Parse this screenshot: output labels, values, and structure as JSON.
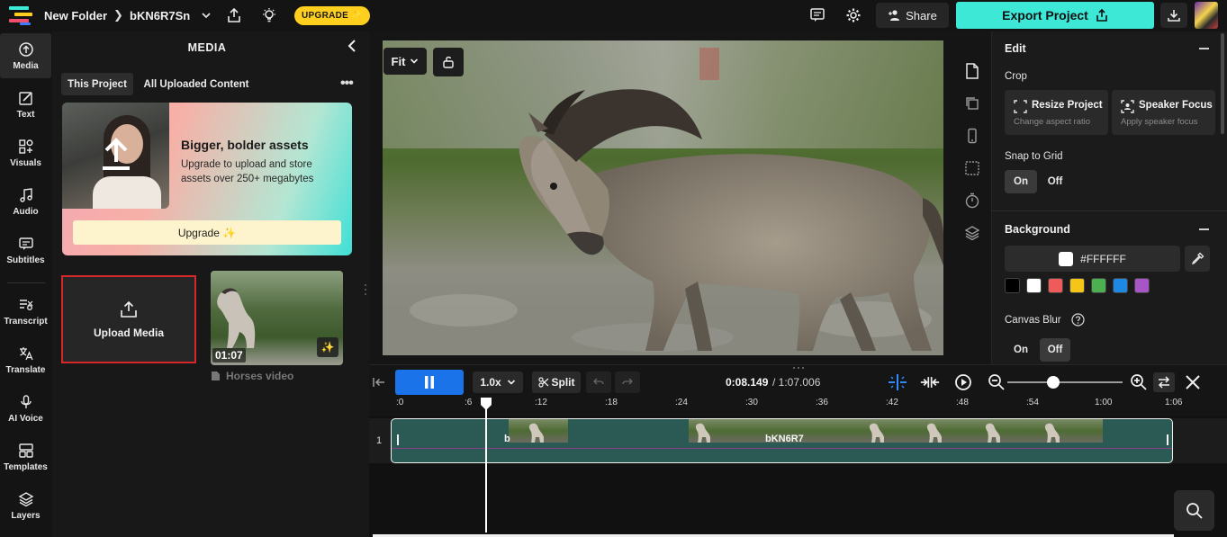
{
  "header": {
    "folder": "New Folder",
    "project": "bKN6R7Sn",
    "upgrade_label": "UPGRADE ✨",
    "share_label": "Share",
    "export_label": "Export Project"
  },
  "rail": [
    {
      "label": "Media",
      "icon": "upload-cloud-icon"
    },
    {
      "label": "Text",
      "icon": "text-edit-icon"
    },
    {
      "label": "Visuals",
      "icon": "visuals-grid-icon"
    },
    {
      "label": "Audio",
      "icon": "music-note-icon"
    },
    {
      "label": "Subtitles",
      "icon": "subtitles-icon"
    },
    {
      "label": "Transcript",
      "icon": "transcript-icon"
    },
    {
      "label": "Translate",
      "icon": "translate-icon"
    },
    {
      "label": "AI Voice",
      "icon": "microphone-icon"
    },
    {
      "label": "Templates",
      "icon": "templates-icon"
    },
    {
      "label": "Layers",
      "icon": "layers-icon"
    }
  ],
  "media": {
    "title": "MEDIA",
    "tabs": [
      "This Project",
      "All Uploaded Content"
    ],
    "promo": {
      "title": "Bigger, bolder assets",
      "desc": "Upgrade to upload and store assets over 250+ megabytes",
      "button": "Upgrade ✨"
    },
    "upload_label": "Upload Media",
    "asset": {
      "duration": "01:07",
      "name": "Horses video"
    }
  },
  "canvas": {
    "fit_label": "Fit"
  },
  "edit_panel": {
    "edit_title": "Edit",
    "crop_label": "Crop",
    "resize_title": "Resize Project",
    "resize_sub": "Change aspect ratio",
    "speaker_title": "Speaker Focus",
    "speaker_sub": "Apply speaker focus",
    "snap_label": "Snap to Grid",
    "on_label": "On",
    "off_label": "Off",
    "background_title": "Background",
    "bg_hex": "#FFFFFF",
    "canvas_blur_label": "Canvas Blur",
    "snap_state": "On",
    "blur_state": "Off",
    "swatches": [
      "#000000",
      "#ffffff",
      "#ef5b5b",
      "#f5c518",
      "#4caf50",
      "#1e88e5",
      "#a855c8"
    ]
  },
  "timeline": {
    "speed": "1.0x",
    "split_label": "Split",
    "current_time": "0:08.149",
    "total_time": "/ 1:07.006",
    "ticks": [
      ":0",
      ":6",
      ":12",
      ":18",
      ":24",
      ":30",
      ":36",
      ":42",
      ":48",
      ":54",
      "1:00",
      "1:06"
    ],
    "track_number": "1",
    "clip_label_a": "b",
    "clip_label_b": "bKN6R7",
    "zoom_level": 0.4
  }
}
